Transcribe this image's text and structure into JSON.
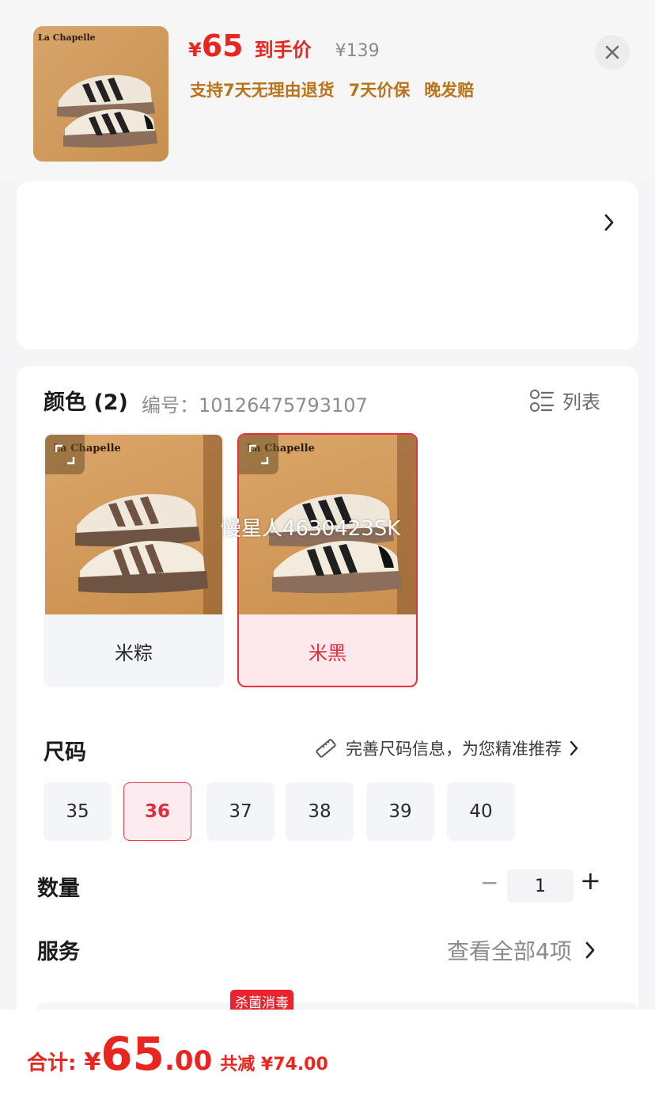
{
  "header": {
    "brand": "La Chapelle",
    "price_yen": "¥",
    "price_value": "65",
    "price_label": "到手价",
    "original_price": "¥139",
    "promos": [
      "支持7天无理由退货",
      "7天价保",
      "晚发赔"
    ],
    "close_icon": "close-icon"
  },
  "color_section": {
    "title": "颜色 (2)",
    "sku": "编号：10126475793107",
    "list_toggle_label": "列表",
    "variants": [
      {
        "brand": "La Chapelle",
        "label": "米粽",
        "selected": false,
        "stripe_color": "#6f5443"
      },
      {
        "brand": "La Chapelle",
        "label": "米黑",
        "selected": true,
        "stripe_color": "#1f1f1f"
      }
    ],
    "watermark": "慢星人4630423SK"
  },
  "size_section": {
    "title": "尺码",
    "link_label": "完善尺码信息，为您精准推荐",
    "sizes": [
      "35",
      "36",
      "37",
      "38",
      "39",
      "40"
    ],
    "selected": "36"
  },
  "quantity_section": {
    "title": "数量",
    "minus": "−",
    "value": "1",
    "plus": "+"
  },
  "service_section": {
    "title": "服务",
    "link_label": "查看全部4项",
    "badge": "杀菌消毒"
  },
  "footer": {
    "total_label": "合计:",
    "total_yen": "¥",
    "total_int": "65",
    "total_dec": ".00",
    "savings": "共减 ¥74.00"
  },
  "colors": {
    "accent_red": "#e8251f",
    "promo_gold": "#b8741a",
    "selected_bg": "#fde9ec"
  }
}
